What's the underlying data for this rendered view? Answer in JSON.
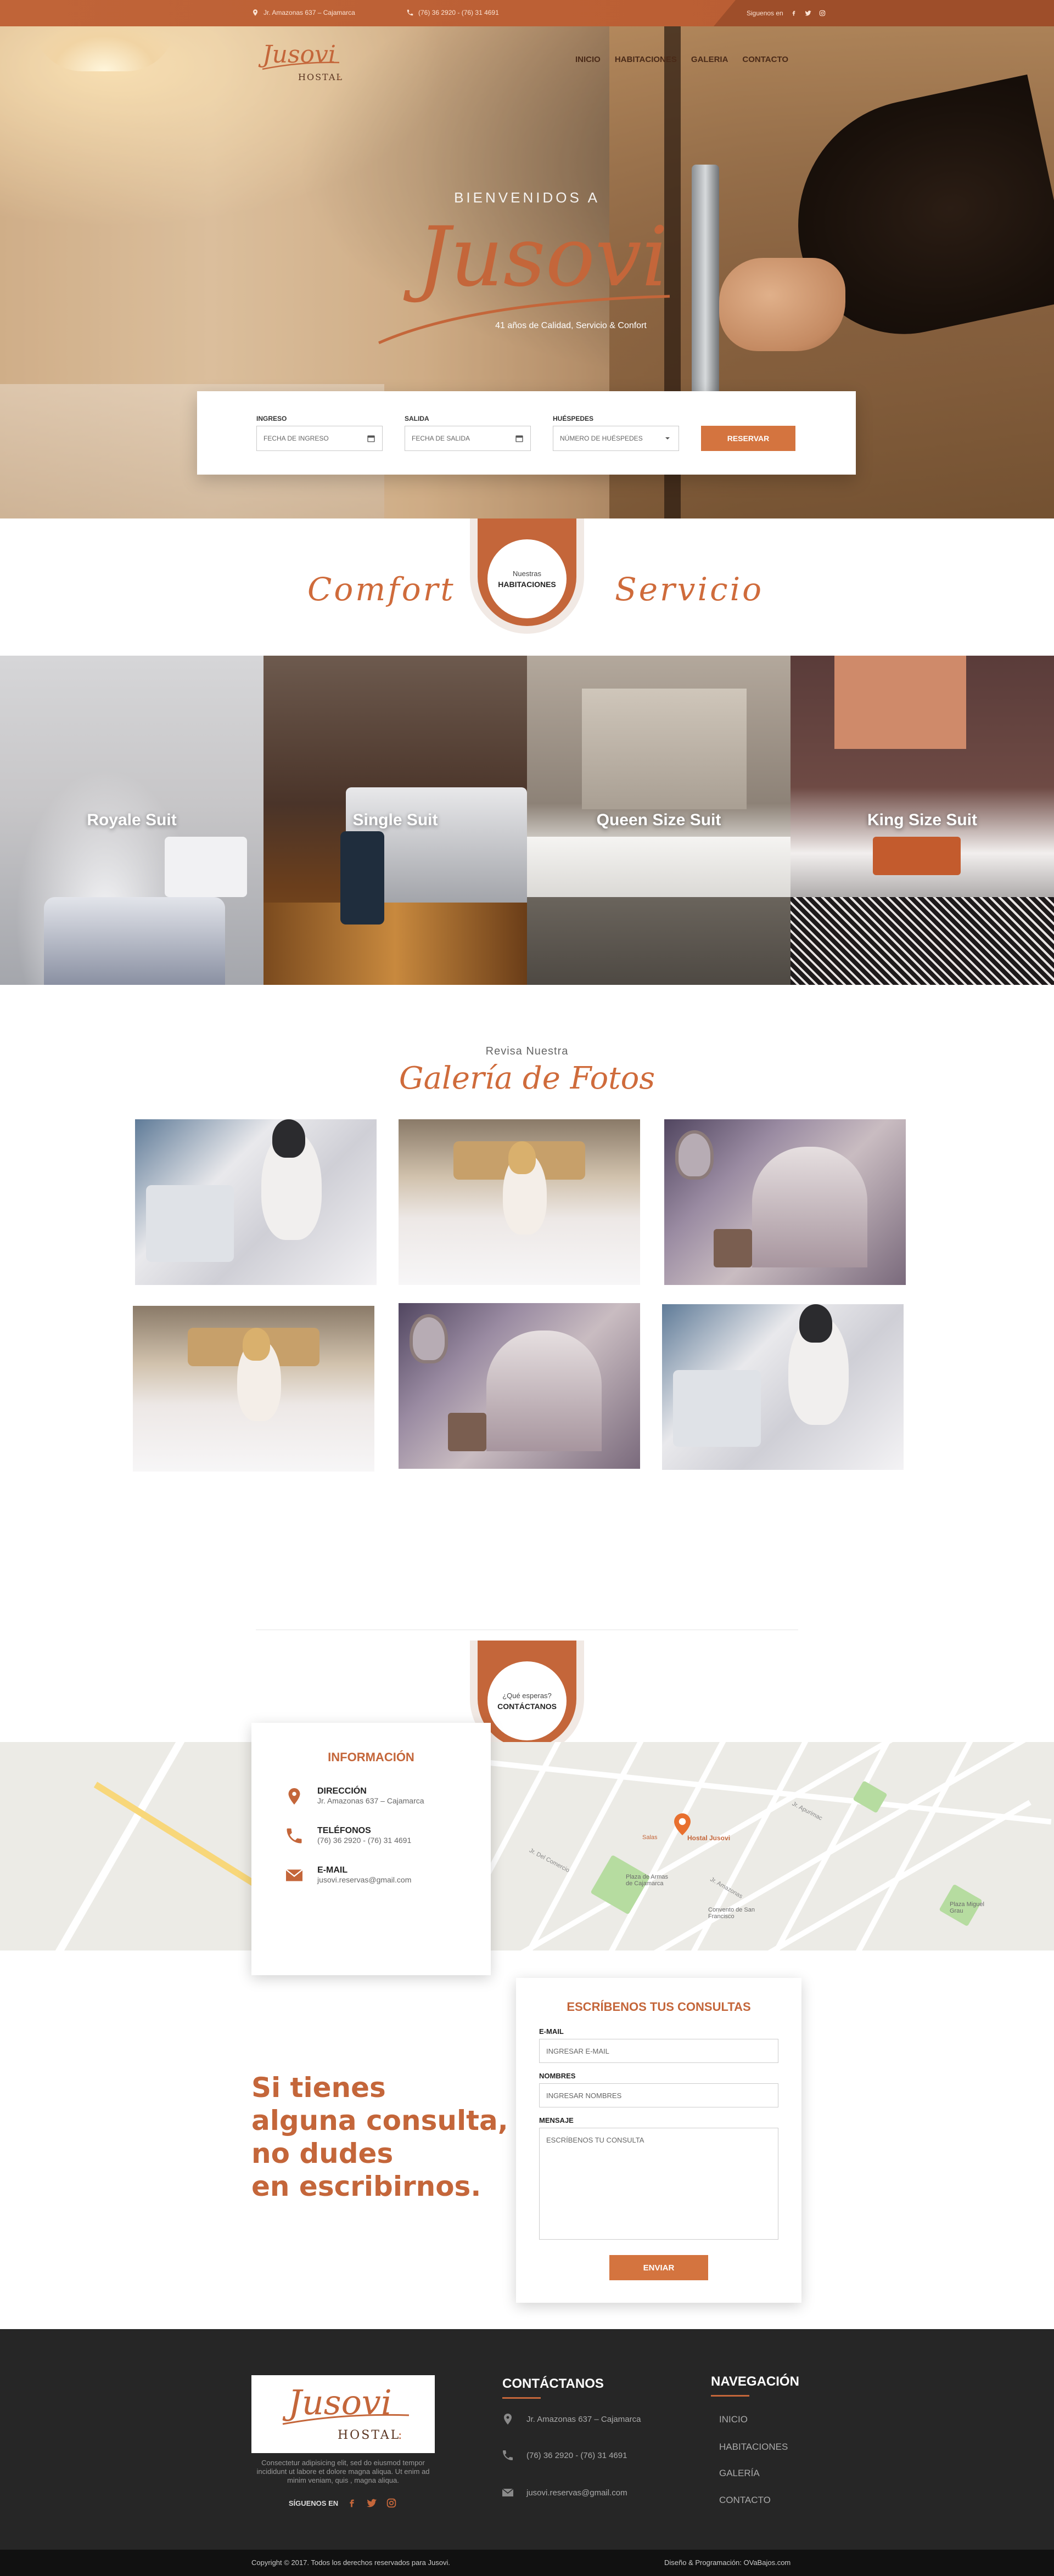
{
  "colors": {
    "accent": "#c4663a",
    "accent_button": "#d4743f",
    "footer_bg": "#262626"
  },
  "topbar": {
    "address": "Jr. Amazonas 637 – Cajamarca",
    "phones": "(76) 36 2920 - (76) 31 4691",
    "follow_label": "Siguenos en",
    "address_icon": "map-pin-icon",
    "phone_icon": "phone-icon"
  },
  "logo": {
    "name": "Jusovi",
    "sub": "HOSTAL"
  },
  "nav": {
    "items": [
      "INICIO",
      "HABITACIONES",
      "GALERIA",
      "CONTACTO"
    ]
  },
  "hero": {
    "welcome": "BIENVENIDOS A",
    "brand": "Jusovi",
    "tagline": "41 años de Calidad, Servicio & Confort"
  },
  "booking": {
    "checkin_label": "INGRESO",
    "checkin_placeholder": "FECHA DE INGRESO",
    "checkout_label": "SALIDA",
    "checkout_placeholder": "FECHA DE SALIDA",
    "guests_label": "HUÉSPEDES",
    "guests_placeholder": "NÚMERO DE HUÉSPEDES",
    "button": "RESERVAR"
  },
  "rooms_section": {
    "left_word": "Comfort",
    "right_word": "Servicio",
    "badge_top": "Nuestras",
    "badge_bottom": "HABITACIONES"
  },
  "rooms": [
    "Royale Suit",
    "Single Suit",
    "Queen Size Suit",
    "King Size Suit"
  ],
  "gallery": {
    "subtitle": "Revisa Nuestra",
    "title": "Galería de Fotos"
  },
  "contact_badge": {
    "top": "¿Qué esperas?",
    "bottom": "CONTÁCTANOS"
  },
  "map": {
    "labels": [
      "Hostal Jusovi",
      "Plaza de Armas de Cajamarca",
      "Convento de San Francisco",
      "Plaza Miguel Grau",
      "Salas",
      "Jr. Amazonas",
      "Jr. Del Comercio",
      "Jr. Apurimac"
    ]
  },
  "info": {
    "title": "INFORMACIÓN",
    "address_label": "DIRECCIÓN",
    "address": "Jr. Amazonas 637 – Cajamarca",
    "phone_label": "TELÉFONOS",
    "phones": "(76) 36 2920 - (76) 31 4691",
    "email_label": "E-MAIL",
    "email": "jusovi.reservas@gmail.com"
  },
  "form": {
    "title": "ESCRÍBENOS TUS CONSULTAS",
    "email_label": "E-MAIL",
    "email_placeholder": "INGRESAR E-MAIL",
    "name_label": "NOMBRES",
    "name_placeholder": "INGRESAR NOMBRES",
    "message_label": "MENSAJE",
    "message_placeholder": "ESCRÍBENOS TU CONSULTA",
    "button": "ENVIAR"
  },
  "big_message": [
    "Si tienes",
    "alguna consulta,",
    "no dudes",
    "en escribirnos."
  ],
  "footer": {
    "desc": "Consectetur adipisicing elit, sed do eiusmod tempor incididunt ut labore et dolore magna aliqua. Ut enim ad minim veniam, quis , magna aliqua.",
    "follow": "SÍGUENOS EN",
    "contact_title": "CONTÁCTANOS",
    "address": "Jr. Amazonas 637 – Cajamarca",
    "phones": "(76) 36 2920 - (76) 31 4691",
    "email": "jusovi.reservas@gmail.com",
    "nav_title": "NAVEGACIÓN",
    "nav_items": [
      "INICIO",
      "HABITACIONES",
      "GALERÍA",
      "CONTACTO"
    ],
    "copyright": "Copyright © 2017. Todos los derechos reservados para Jusovi.",
    "credits": "Diseño & Programación: OVaBajos.com"
  }
}
